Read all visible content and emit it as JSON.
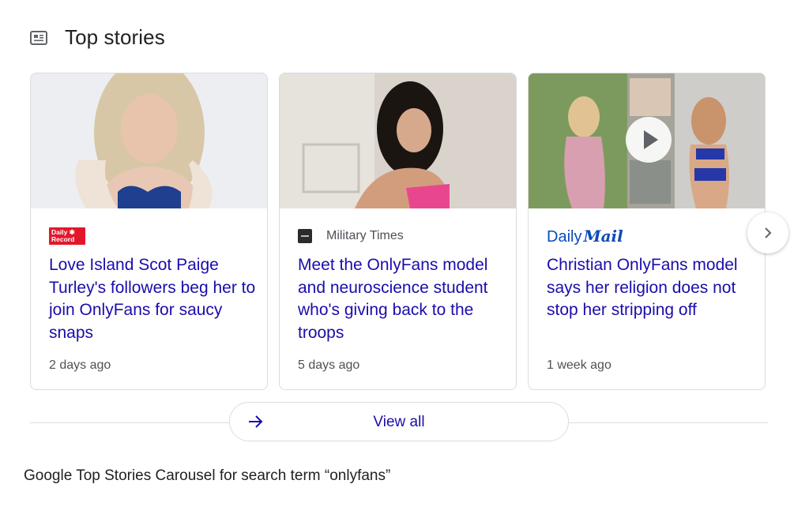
{
  "section": {
    "title": "Top stories",
    "icon": "newspaper-icon"
  },
  "cards": [
    {
      "source_logo": "Daily Record",
      "headline": "Love Island Scot Paige Turley's followers beg her to join OnlyFans for saucy snaps",
      "age": "2 days ago"
    },
    {
      "source": "Military Times",
      "headline": "Meet the OnlyFans model and neuroscience student who's giving back to the troops",
      "age": "5 days ago"
    },
    {
      "source_logo_a": "Daily",
      "source_logo_b": "Mail",
      "headline": "Christian OnlyFans model says her religion does not stop her stripping off",
      "age": "1 week ago",
      "has_video": true
    }
  ],
  "view_all": {
    "label": "View all"
  },
  "caption": "Google Top Stories Carousel for search term “onlyfans”",
  "colors": {
    "link": "#1a0dab",
    "meta": "#4d5156",
    "border": "#dadce0"
  }
}
